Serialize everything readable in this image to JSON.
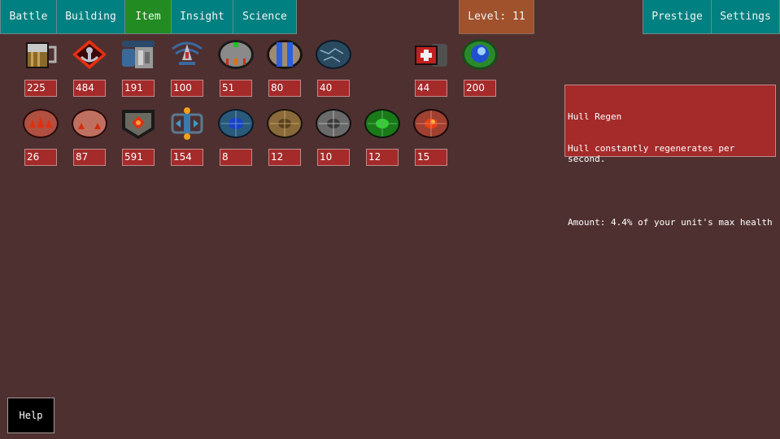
{
  "nav": {
    "tabs": [
      {
        "label": "Battle",
        "active": false
      },
      {
        "label": "Building",
        "active": false
      },
      {
        "label": "Item",
        "active": true
      },
      {
        "label": "Insight",
        "active": false
      },
      {
        "label": "Science",
        "active": false
      }
    ],
    "level_label": "Level: 11",
    "right_tabs": [
      {
        "label": "Prestige"
      },
      {
        "label": "Settings"
      }
    ]
  },
  "colors": {
    "background": "#4f3030",
    "tab_teal": "#008080",
    "tab_active": "#228b22",
    "level_badge": "#a0522d",
    "count_box": "#a52a2a"
  },
  "items_row1": [
    {
      "icon": "beer-mug-icon",
      "count": "225"
    },
    {
      "icon": "flaming-anchor-emblem-icon",
      "count": "484"
    },
    {
      "icon": "armored-machine-icon",
      "count": "191"
    },
    {
      "icon": "radar-ship-icon",
      "count": "100"
    },
    {
      "icon": "metal-barrel-core-icon",
      "count": "51"
    },
    {
      "icon": "blue-capsule-shield-icon",
      "count": "80"
    },
    {
      "icon": "cracked-blue-orb-icon",
      "count": "40"
    },
    {
      "icon": "medkit-hull-regen-icon",
      "count": "44"
    },
    {
      "icon": "green-ring-blue-orb-icon",
      "count": "200"
    }
  ],
  "items_row2": [
    {
      "icon": "red-claw-shield-icon",
      "count": "26"
    },
    {
      "icon": "pink-claw-shield-icon",
      "count": "87"
    },
    {
      "icon": "dark-red-core-plate-icon",
      "count": "591"
    },
    {
      "icon": "blue-engine-frame-icon",
      "count": "154"
    },
    {
      "icon": "blue-gem-shield-icon",
      "count": "8"
    },
    {
      "icon": "bronze-gem-shield-icon",
      "count": "12"
    },
    {
      "icon": "silver-gem-shield-icon",
      "count": "10"
    },
    {
      "icon": "green-gem-shield-icon",
      "count": "12"
    },
    {
      "icon": "red-gem-shield-icon",
      "count": "15"
    }
  ],
  "tooltip": {
    "title": "Hull Regen",
    "description": "Hull constantly regenerates per second.",
    "amount": "Amount: 4.4% of your unit's max health"
  },
  "help_label": "Help"
}
